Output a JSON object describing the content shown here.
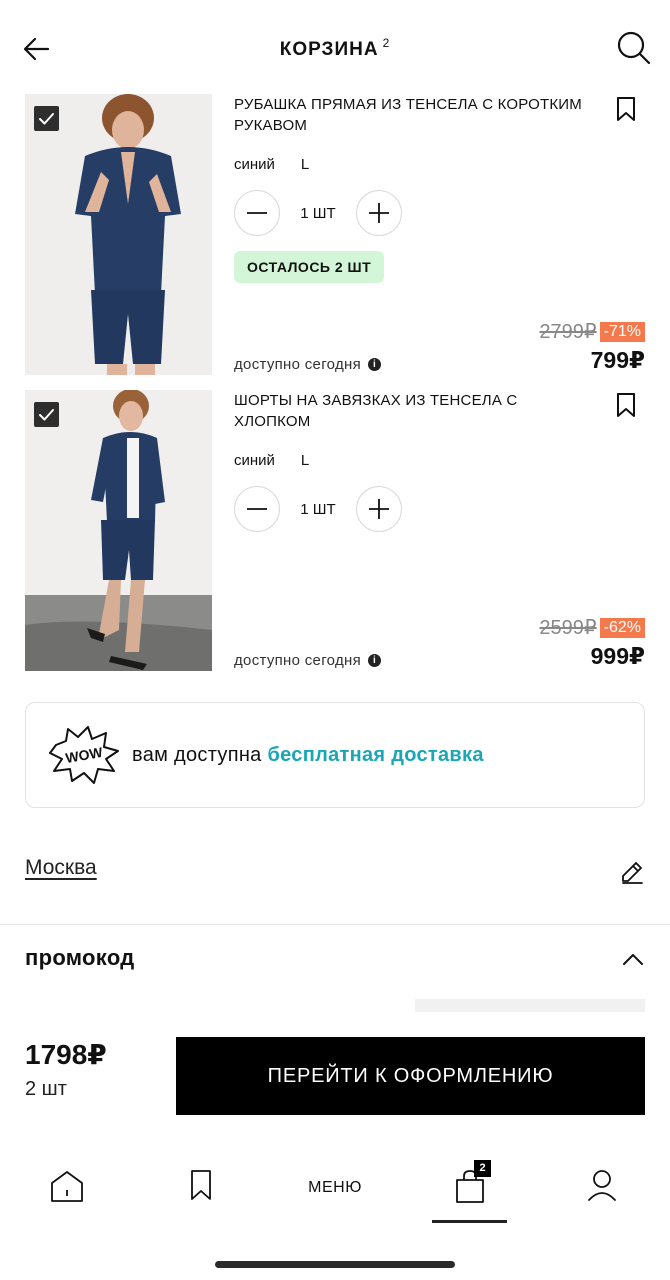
{
  "header": {
    "title": "КОРЗИНА",
    "count": "2"
  },
  "items": [
    {
      "name": "РУБАШКА ПРЯМАЯ ИЗ ТЕНСЕЛА С КОРОТКИМ РУКАВОМ",
      "color": "синий",
      "size": "L",
      "quantity": "1 ШТ",
      "stock_badge": "ОСТАЛОСЬ 2 ШТ",
      "availability": "доступно сегодня",
      "old_price": "2799₽",
      "discount": "-71%",
      "price": "799₽",
      "checked": true
    },
    {
      "name": "ШОРТЫ НА ЗАВЯЗКАХ ИЗ ТЕНСЕЛА С ХЛОПКОМ",
      "color": "синий",
      "size": "L",
      "quantity": "1 ШТ",
      "availability": "доступно сегодня",
      "old_price": "2599₽",
      "discount": "-62%",
      "price": "999₽",
      "checked": true
    }
  ],
  "delivery": {
    "badge": "WOW",
    "text": "вам доступна",
    "accent": "бесплатная доставка"
  },
  "city": "Москва",
  "promo": {
    "title": "промокод"
  },
  "summary": {
    "total": "1798₽",
    "count": "2 шт",
    "checkout_label": "ПЕРЕЙТИ К ОФОРМЛЕНИЮ"
  },
  "tabbar": {
    "menu_label": "МЕНЮ",
    "cart_count": "2",
    "active_tab": "cart"
  },
  "colors": {
    "accent": "#17a7b5",
    "discount": "#f47a4e",
    "stock_badge_bg": "#d3f6d8",
    "product_navy": "#263e66"
  },
  "icons": [
    "back-arrow-icon",
    "search-icon",
    "checkbox-icon",
    "bookmark-icon",
    "minus-icon",
    "plus-icon",
    "info-icon",
    "wow-badge-icon",
    "pencil-icon",
    "chevron-up-icon",
    "home-icon",
    "bookmark-icon",
    "cart-bag-icon",
    "profile-icon"
  ]
}
